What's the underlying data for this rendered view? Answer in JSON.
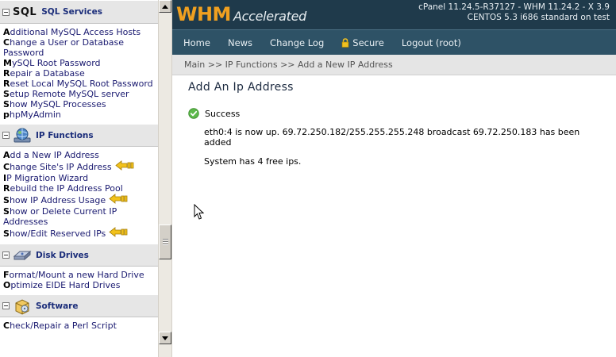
{
  "sidebar": {
    "sections": [
      {
        "sql_word": "SQL",
        "title": "SQL Services",
        "items": [
          "Additional MySQL Access Hosts",
          "Change a User or Database Password",
          "MySQL Root Password",
          "Repair a Database",
          "Reset Local MySQL Root Password",
          "Setup Remote MySQL server",
          "Show MySQL Processes",
          "phpMyAdmin"
        ]
      },
      {
        "title": "IP Functions",
        "items": [
          "Add a New IP Address",
          "Change Site's IP Address",
          "IP Migration Wizard",
          "Rebuild the IP Address Pool",
          "Show IP Address Usage",
          "Show or Delete Current IP Addresses",
          "Show/Edit Reserved IPs"
        ]
      },
      {
        "title": "Disk Drives",
        "items": [
          "Format/Mount a new Hard Drive",
          "Optimize EIDE Hard Drives"
        ]
      },
      {
        "title": "Software",
        "items": [
          "Check/Repair a Perl Script"
        ]
      }
    ]
  },
  "header": {
    "logo_main": "WHM",
    "logo_sub": "Accelerated",
    "version_line1": "cPanel 11.24.5-R37127 - WHM 11.24.2 - X 3.9",
    "version_line2": "CENTOS 5.3 i686 standard on test"
  },
  "nav": {
    "home": "Home",
    "news": "News",
    "changelog": "Change Log",
    "secure": "Secure",
    "logout": "Logout (root)"
  },
  "breadcrumb": "Main >> IP Functions >> Add a New IP Address",
  "main": {
    "title": "Add An Ip Address",
    "status": "Success",
    "message": "eth0:4 is now up. 69.72.250.182/255.255.255.248 broadcast 69.72.250.183 has been added",
    "free_ips": "System has 4 free ips."
  },
  "colors": {
    "topbar": "#1f3a4b",
    "navbar": "#2e5266",
    "logo_accent": "#f0a020",
    "link": "#1a1a70"
  }
}
